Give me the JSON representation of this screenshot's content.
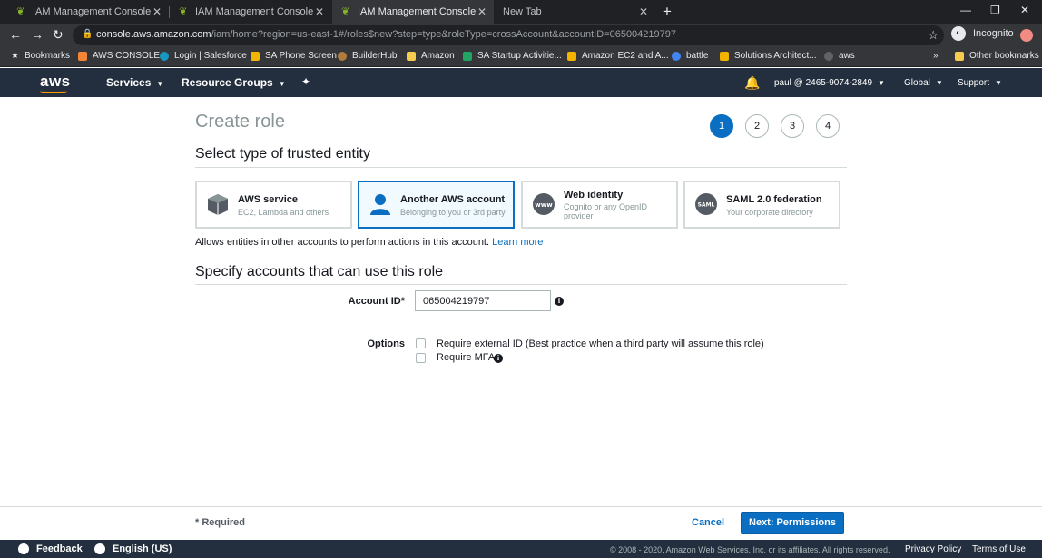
{
  "browser": {
    "tabs": [
      {
        "title": "IAM Management Console",
        "active": false
      },
      {
        "title": "IAM Management Console",
        "active": false
      },
      {
        "title": "IAM Management Console",
        "active": true
      },
      {
        "title": "New Tab",
        "active": false
      }
    ],
    "url_host": "console.aws.amazon.com",
    "url_path": "/iam/home?region=us-east-1#/roles$new?step=type&roleType=crossAccount&accountID=065004219797",
    "profile_label": "Incognito",
    "bookmarks": [
      {
        "label": "Bookmarks",
        "color": "#e8eaed"
      },
      {
        "label": "AWS CONSOLE",
        "color": "#f58536"
      },
      {
        "label": "Login | Salesforce",
        "color": "#1798c1"
      },
      {
        "label": "SA Phone Screen",
        "color": "#f3b400"
      },
      {
        "label": "BuilderHub",
        "color": "#b07b3c"
      },
      {
        "label": "Amazon",
        "color": "#f7cb4d"
      },
      {
        "label": "SA Startup Activitie...",
        "color": "#21a464"
      },
      {
        "label": "Amazon EC2 and A...",
        "color": "#f3b400"
      },
      {
        "label": "battle",
        "color": "#4285f4"
      },
      {
        "label": "Solutions Architect...",
        "color": "#f3b400"
      },
      {
        "label": "aws",
        "color": "#202124"
      }
    ],
    "more_bookmarks": "»",
    "other_bookmarks": "Other bookmarks"
  },
  "awsnav": {
    "logo": "aws",
    "services": "Services",
    "resource_groups": "Resource Groups",
    "account": "paul @ 2465-9074-2849",
    "region": "Global",
    "support": "Support"
  },
  "main": {
    "title": "Create role",
    "steps": [
      "1",
      "2",
      "3",
      "4"
    ],
    "active_step": 1,
    "section1": "Select type of trusted entity",
    "cards": [
      {
        "title": "AWS service",
        "subtitle": "EC2, Lambda and others",
        "icon": "cube-icon"
      },
      {
        "title": "Another AWS account",
        "subtitle": "Belonging to you or 3rd party",
        "icon": "user-icon",
        "selected": true
      },
      {
        "title": "Web identity",
        "subtitle": "Cognito or any OpenID provider",
        "icon": "www-icon"
      },
      {
        "title": "SAML 2.0 federation",
        "subtitle": "Your corporate directory",
        "icon": "saml-icon"
      }
    ],
    "hint": "Allows entities in other accounts to perform actions in this account.",
    "learn_more": "Learn more",
    "section2": "Specify accounts that can use this role",
    "account_id_label": "Account ID*",
    "account_id_value": "065004219797",
    "options_label": "Options",
    "option1": "Require external ID (Best practice when a third party will assume this role)",
    "option2": "Require MFA"
  },
  "footer": {
    "required": "* Required",
    "cancel": "Cancel",
    "next": "Next: Permissions",
    "feedback": "Feedback",
    "language": "English (US)",
    "copyright": "© 2008 - 2020, Amazon Web Services, Inc. or its affiliates. All rights reserved.",
    "privacy": "Privacy Policy",
    "terms": "Terms of Use"
  }
}
